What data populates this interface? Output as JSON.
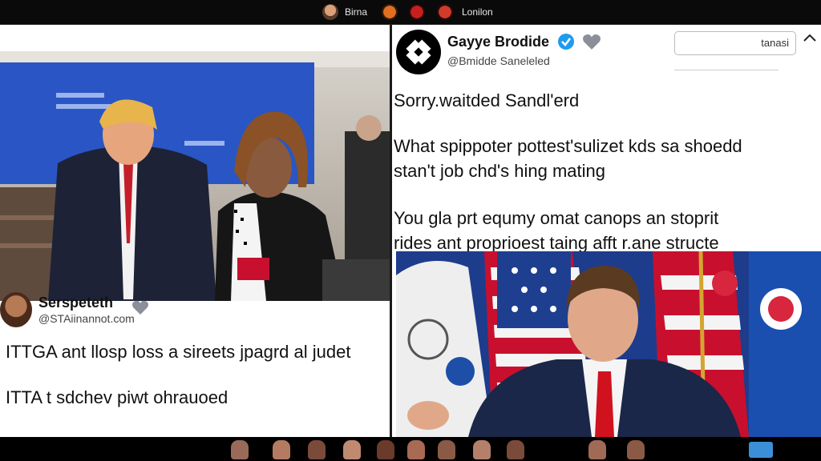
{
  "topbar": {
    "left_label": "Birna",
    "right_label": "Lonilon"
  },
  "left_pane": {
    "comment": {
      "name": "Serspeteth",
      "handle": "@STAiinannot.com",
      "line1": "ITTGA ant llosp loss a sireets jpagrd al judet",
      "line2": "ITTA t sdchev piwt ohrauoed"
    }
  },
  "right_pane": {
    "header": {
      "name": "Gayye Brodide",
      "handle": "@Bmidde Saneleled",
      "search_value": "tanasi"
    },
    "post": {
      "line1": "Sorry.waitded Sandl'erd",
      "line2": "What spippoter pottest'sulizet kds sa shoedd",
      "line3": "stan't job chd's hing mating",
      "line4": "You gla prt equmy omat canops an stoprit",
      "line5": "rides ant proprioest taing afft r.ane structe"
    }
  },
  "colors": {
    "verified": "#1d9bf0",
    "flag_red": "#c8102e",
    "flag_blue": "#1e3f8f"
  },
  "icons": {
    "verified": "verified-badge-icon",
    "like": "heart-icon",
    "chevron": "chevron-up-icon"
  }
}
